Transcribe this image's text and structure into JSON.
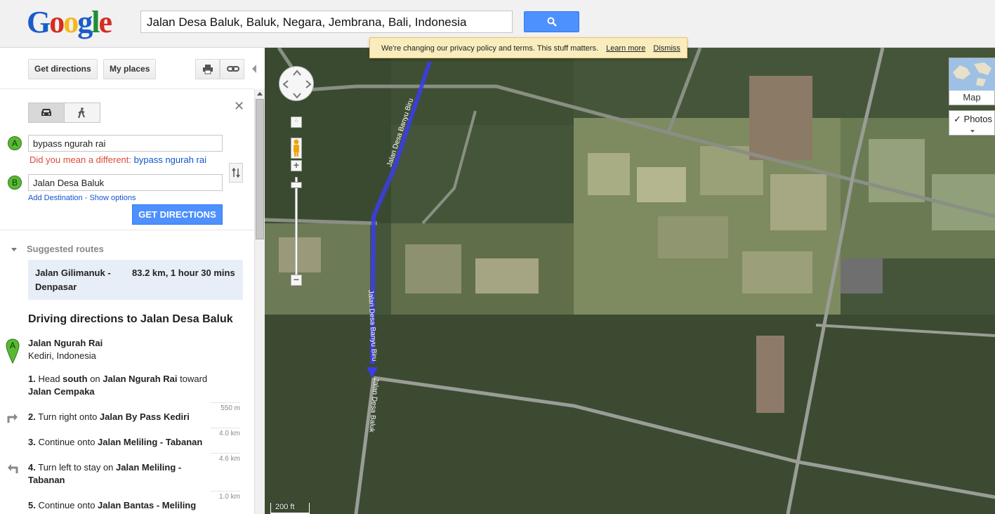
{
  "header": {
    "logo_letters": [
      "G",
      "o",
      "o",
      "g",
      "l",
      "e"
    ],
    "logo_colors": [
      "#1a5dc9",
      "#d62d20",
      "#f6b91a",
      "#1a5dc9",
      "#1f8f32",
      "#d62d20"
    ],
    "search_value": "Jalan Desa Baluk, Baluk, Negara, Jembrana, Bali, Indonesia",
    "search_button_icon": "search-icon"
  },
  "privacy_bar": {
    "message": "We're changing our privacy policy and terms. This stuff matters.",
    "learn_more": "Learn more",
    "dismiss": "Dismiss"
  },
  "panel": {
    "get_directions_tab": "Get directions",
    "my_places_tab": "My places",
    "print_icon": "print-icon",
    "link_icon": "link-icon",
    "modes": [
      "car-icon",
      "walk-icon"
    ],
    "close": "✕",
    "waypoints": [
      {
        "marker": "A",
        "value": "bypass ngurah rai"
      },
      {
        "marker": "B",
        "value": "Jalan Desa Baluk"
      }
    ],
    "did_you_mean_prefix": "Did you mean a different:",
    "did_you_mean_link": "bypass ngurah rai",
    "add_destination": "Add Destination",
    "link_separator": "-",
    "show_options": "Show options",
    "get_directions_button": "GET DIRECTIONS"
  },
  "routes": {
    "heading": "Suggested routes",
    "suggested": [
      {
        "name": "Jalan Gilimanuk - Denpasar",
        "summary": "83.2 km, 1 hour 30 mins"
      }
    ]
  },
  "directions": {
    "title": "Driving directions to Jalan Desa Baluk",
    "start_marker": "A",
    "start_name": "Jalan Ngurah Rai",
    "start_sub": "Kediri, Indonesia",
    "steps": [
      {
        "num": "1.",
        "text_a": "Head",
        "bold_a": "south",
        "text_b": "on",
        "bold_b": "Jalan Ngurah Rai",
        "text_c": "toward",
        "bold_c": "Jalan Cempaka",
        "distance": "550 m"
      },
      {
        "num": "2.",
        "text_a": "Turn right onto",
        "bold_a": "Jalan By Pass Kediri",
        "distance": "4.0 km"
      },
      {
        "num": "3.",
        "text_a": "Continue onto",
        "bold_a": "Jalan Meliling - Tabanan",
        "distance": "4.6 km"
      },
      {
        "num": "4.",
        "text_a": "Turn left to stay on",
        "bold_a": "Jalan Meliling - Tabanan",
        "distance": "1.0 km"
      },
      {
        "num": "5.",
        "text_a": "Continue onto",
        "bold_a": "Jalan Bantas - Meliling"
      }
    ]
  },
  "map": {
    "road_labels": [
      "Jalan Desa Banyu Biru",
      "Jalan Desa Banyu Biru",
      "Jalan Desa Baluk"
    ],
    "maptype_label": "Map",
    "photos_label": "Photos",
    "photos_check": "✓",
    "scale_label": "200 ft",
    "route_color": "#3c3cf0"
  }
}
